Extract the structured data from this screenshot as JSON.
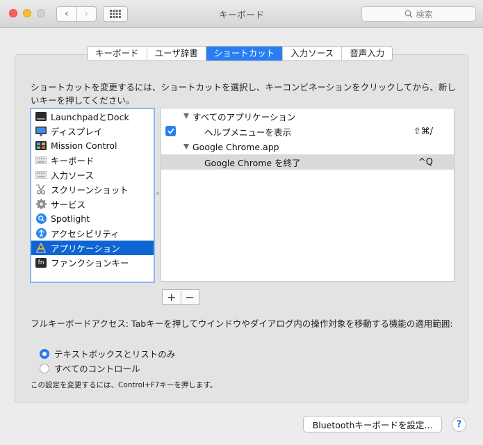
{
  "window": {
    "title": "キーボード",
    "search_placeholder": "検索",
    "back_glyph": "‹",
    "forward_glyph": "›"
  },
  "tabs": [
    {
      "label": "キーボード",
      "active": false
    },
    {
      "label": "ユーザ辞書",
      "active": false
    },
    {
      "label": "ショートカット",
      "active": true
    },
    {
      "label": "入力ソース",
      "active": false
    },
    {
      "label": "音声入力",
      "active": false
    }
  ],
  "instruction": "ショートカットを変更するには、ショートカットを選択し、キーコンビネーションをクリックしてから、新しいキーを押してください。",
  "categories": [
    {
      "label": "LaunchpadとDock",
      "icon": "launchpad-dock-icon",
      "selected": false
    },
    {
      "label": "ディスプレイ",
      "icon": "display-icon",
      "selected": false
    },
    {
      "label": "Mission Control",
      "icon": "mission-control-icon",
      "selected": false
    },
    {
      "label": "キーボード",
      "icon": "keyboard-icon",
      "selected": false
    },
    {
      "label": "入力ソース",
      "icon": "input-source-icon",
      "selected": false
    },
    {
      "label": "スクリーンショット",
      "icon": "screenshot-icon",
      "selected": false
    },
    {
      "label": "サービス",
      "icon": "gear-icon",
      "selected": false
    },
    {
      "label": "Spotlight",
      "icon": "spotlight-icon",
      "selected": false
    },
    {
      "label": "アクセシビリティ",
      "icon": "accessibility-icon",
      "selected": false
    },
    {
      "label": "アプリケーション",
      "icon": "app-store-icon",
      "selected": true
    },
    {
      "label": "ファンクションキー",
      "icon": "fn-key-icon",
      "selected": false
    }
  ],
  "fn_icon_text": "fn",
  "shortcuts": [
    {
      "type": "group",
      "label": "すべてのアプリケーション"
    },
    {
      "type": "item",
      "label": "ヘルプメニューを表示",
      "key": "⇧⌘/",
      "checked": true,
      "highlight": false
    },
    {
      "type": "group",
      "label": "Google Chrome.app"
    },
    {
      "type": "item",
      "label": "Google Chrome を終了",
      "key": "^Q",
      "checked": false,
      "highlight": true
    }
  ],
  "buttons": {
    "add": "+",
    "remove": "−",
    "bluetooth": "Bluetoothキーボードを設定...",
    "help": "?"
  },
  "full_keyboard_access": {
    "description": "フルキーボードアクセス: Tabキーを押してウインドウやダイアログ内の操作対象を移動する機能の適用範囲:",
    "options": [
      {
        "label": "テキストボックスとリストのみ",
        "selected": true
      },
      {
        "label": "すべてのコントロール",
        "selected": false
      }
    ],
    "note": "この設定を変更するには、Control+F7キーを押します。"
  }
}
